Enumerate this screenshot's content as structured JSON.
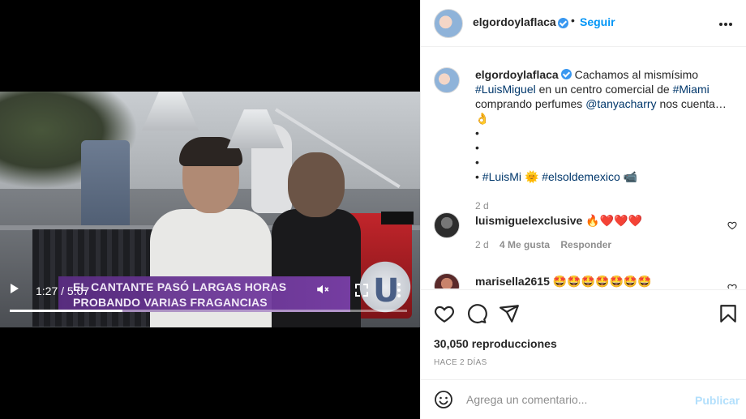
{
  "video": {
    "chyron_text": "EL CANTANTE PASÓ LARGAS HORAS PROBANDO VARIAS FRAGANCIAS",
    "time_display": "1:27 / 5:07",
    "progress_fraction": 0.283
  },
  "post": {
    "author": "elgordoylaflaca",
    "follow_label": "Seguir",
    "caption": {
      "lead": "Cachamos al mismísimo",
      "tag_luismiguel": "#LuisMiguel",
      "mid1": "en un centro comercial de",
      "tag_miami": "#Miami",
      "mid2": "comprando perfumes",
      "mention": "@tanyacharry",
      "tail": "nos cuenta… 👌",
      "bullets": [
        "•",
        "•",
        "•"
      ],
      "last_bullet": "•",
      "tag_luismi": "#LuisMi",
      "sun_emoji": "🌞",
      "tag_elsoldemexico": "#elsoldemexico",
      "camera_emoji": "📹"
    },
    "caption_time": "2 d"
  },
  "comments": [
    {
      "username": "luismiguelexclusive",
      "text": "🔥❤️❤️❤️",
      "time": "2 d",
      "likes": "4 Me gusta",
      "reply": "Responder"
    },
    {
      "username": "marisella2615",
      "text": "🤩🤩🤩🤩🤩🤩🤩"
    }
  ],
  "stats": {
    "views": "30,050 reproducciones",
    "posted": "HACE 2 DÍAS"
  },
  "add_comment": {
    "placeholder": "Agrega un comentario...",
    "publish_label": "Publicar"
  },
  "colors": {
    "link": "#00376b",
    "follow": "#0095f6",
    "publish_disabled": "#b2dffc",
    "verified": "#3897f0"
  },
  "icons": [
    "play-icon",
    "mute-icon",
    "fullscreen-icon",
    "more-vertical-icon",
    "verified-icon",
    "more-horizontal-icon",
    "heart-icon",
    "comment-icon",
    "share-icon",
    "bookmark-icon",
    "emoji-icon"
  ]
}
